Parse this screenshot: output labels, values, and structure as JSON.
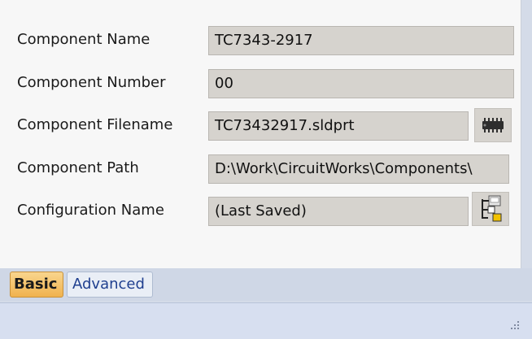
{
  "fields": [
    {
      "label": "Component Name",
      "value": "TC7343-2917"
    },
    {
      "label": "Component Number",
      "value": "00"
    },
    {
      "label": "Component Filename",
      "value": "TC73432917.sldprt"
    },
    {
      "label": "Component Path",
      "value": "D:\\Work\\CircuitWorks\\Components\\"
    },
    {
      "label": "Configuration Name",
      "value": "(Last Saved)"
    }
  ],
  "tabs": {
    "basic": "Basic",
    "advanced": "Advanced"
  },
  "icons": {
    "filename_button": "chip-icon",
    "configuration_button": "configuration-tree-icon"
  },
  "colors": {
    "field_bg": "#d6d3ce",
    "active_tab": "#f0b24e",
    "tab_text": "#1f3f8f"
  }
}
